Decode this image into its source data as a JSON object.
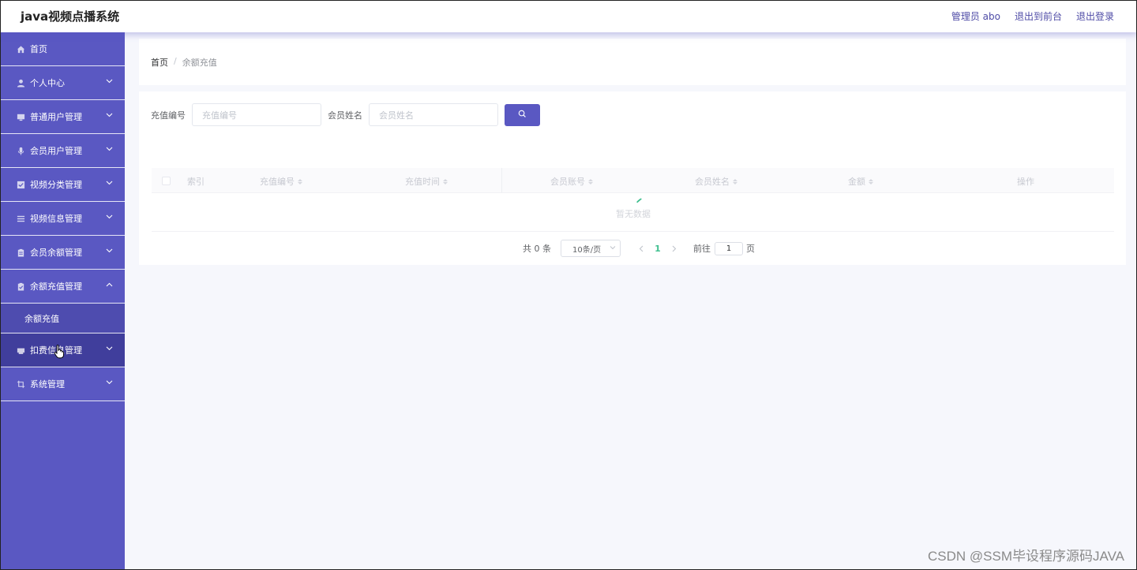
{
  "header": {
    "title": "java视频点播系统",
    "user": "管理员 abo",
    "to_frontend": "退出到前台",
    "logout": "退出登录"
  },
  "sidebar": {
    "items": [
      {
        "label": "首页",
        "icon": "home-icon"
      },
      {
        "label": "个人中心",
        "icon": "user-icon"
      },
      {
        "label": "普通用户管理",
        "icon": "monitor-icon"
      },
      {
        "label": "会员用户管理",
        "icon": "microphone-icon"
      },
      {
        "label": "视频分类管理",
        "icon": "checkbox-icon"
      },
      {
        "label": "视频信息管理",
        "icon": "list-icon"
      },
      {
        "label": "会员余额管理",
        "icon": "clipboard-icon"
      },
      {
        "label": "余额充值管理",
        "icon": "clipboard-check-icon"
      },
      {
        "label": "扣费信息管理",
        "icon": "printer-icon"
      },
      {
        "label": "系统管理",
        "icon": "crop-icon"
      }
    ],
    "submenu": {
      "label": "余额充值"
    }
  },
  "breadcrumb": {
    "home": "首页",
    "separator": "/",
    "current": "余额充值"
  },
  "search": {
    "label1": "充值编号",
    "placeholder1": "充值编号",
    "label2": "会员姓名",
    "placeholder2": "会员姓名"
  },
  "table": {
    "columns": [
      "索引",
      "充值编号",
      "充值时间",
      "会员账号",
      "会员姓名",
      "金额",
      "操作"
    ],
    "empty_text": "暂无数据"
  },
  "pagination": {
    "total": "共 0 条",
    "page_size": "10条/页",
    "current_page": "1",
    "goto_label": "前往",
    "goto_value": "1",
    "page_unit": "页"
  },
  "watermark": "CSDN @SSM毕设程序源码JAVA",
  "colors": {
    "sidebar": "#5a58c2",
    "accent": "#5a58c2",
    "active_page": "#3fbf8f"
  }
}
